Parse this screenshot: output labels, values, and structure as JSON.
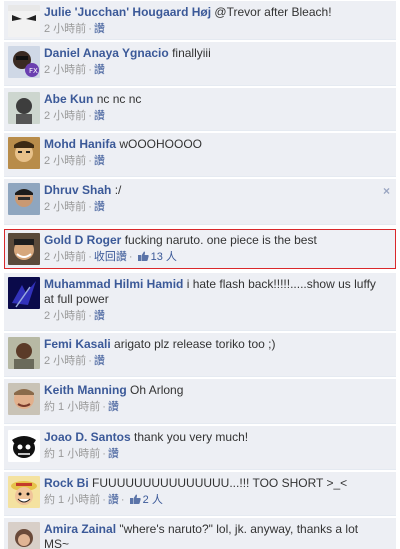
{
  "colors": {
    "link": "#3b5998",
    "highlight_border": "#d9282b",
    "bg": "#edeff4"
  },
  "comments": [
    {
      "name": "Julie 'Jucchan' Hougaard Høj",
      "text": "@Trevor after Bleach!",
      "time": "2 小時前",
      "like": "讚"
    },
    {
      "name": "Daniel Anaya Ygnacio",
      "text": "finallyiii",
      "time": "2 小時前",
      "like": "讚"
    },
    {
      "name": "Abe Kun",
      "text": "nc nc nc",
      "time": "2 小時前",
      "like": "讚"
    },
    {
      "name": "Mohd Hanifa",
      "text": "wOOOHOOOO",
      "time": "2 小時前",
      "like": "讚"
    },
    {
      "name": "Dhruv Shah",
      "text": ":/",
      "time": "2 小時前",
      "like": "讚",
      "close": "×"
    },
    {
      "name": "Gold D Roger",
      "text": "fucking naruto. one piece is the best",
      "time": "2 小時前",
      "like": "收回讚",
      "likes_count": "13 人"
    },
    {
      "name": "Muhammad Hilmi Hamid",
      "text": "i hate flash back!!!!!.....show us luffy at full power",
      "time": "2 小時前",
      "like": "讚"
    },
    {
      "name": "Femi Kasali",
      "text": "arigato plz release toriko too ;)",
      "time": "2 小時前",
      "like": "讚"
    },
    {
      "name": "Keith Manning",
      "text": "Oh Arlong",
      "time": "約 1 小時前",
      "like": "讚"
    },
    {
      "name": "Joao D. Santos",
      "text": "thank you very much!",
      "time": "約 1 小時前",
      "like": "讚"
    },
    {
      "name": "Rock Bi",
      "text": "FUUUUUUUUUUUUUUU...!!! TOO SHORT >_<",
      "time": "約 1 小時前",
      "like": "讚",
      "likes_count": "2 人"
    },
    {
      "name": "Amira Zainal",
      "text": "\"where's naruto?\" lol, jk. anyway, thanks a lot MS~",
      "time": "",
      "like": ""
    }
  ]
}
